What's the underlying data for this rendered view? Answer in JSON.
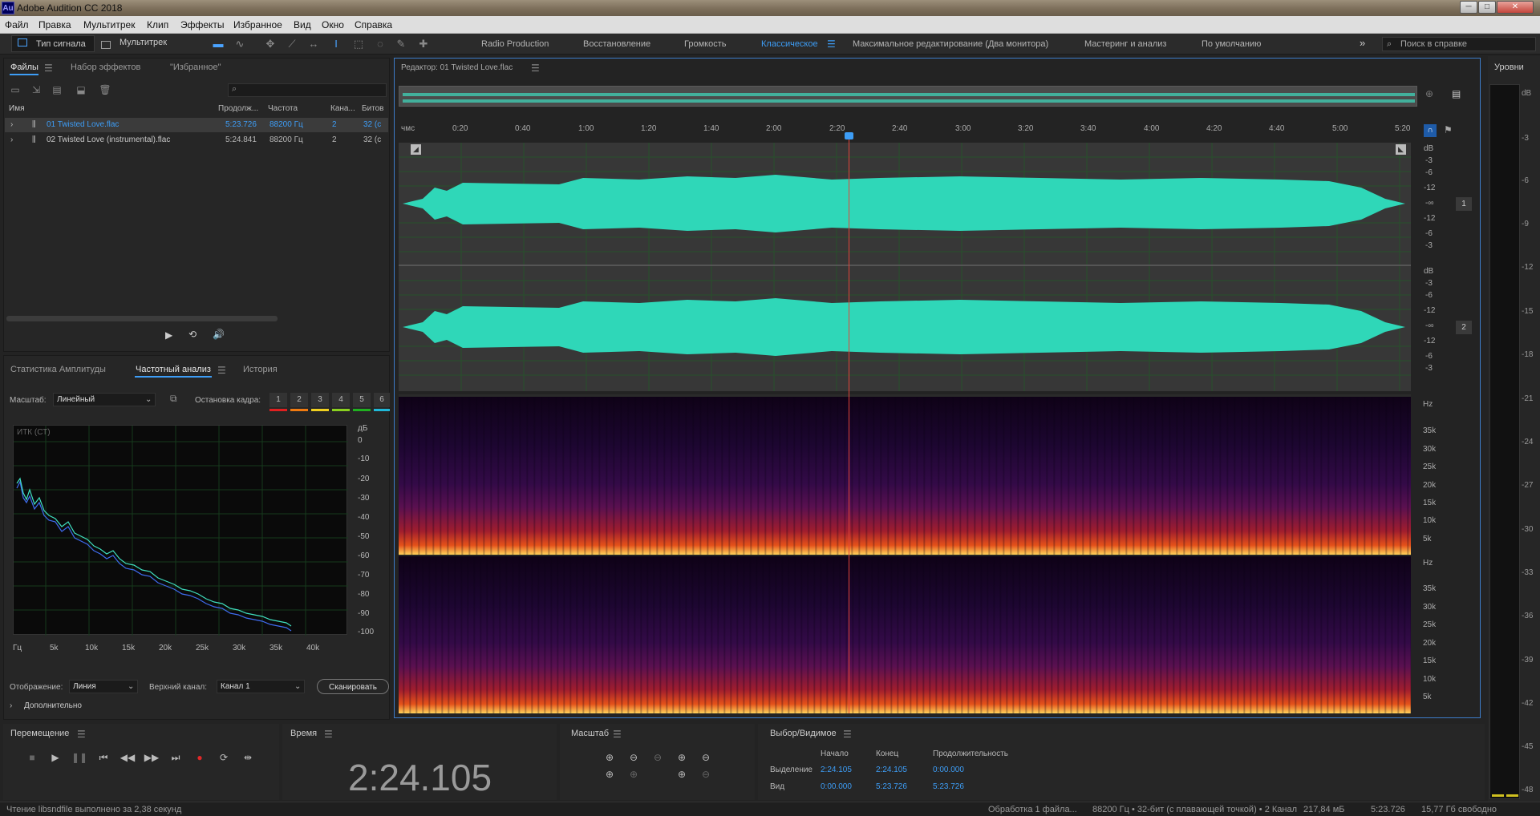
{
  "window": {
    "title": "Adobe Audition CC 2018",
    "icon": "Au",
    "minimize": "─",
    "maximize": "□",
    "close": "✕"
  },
  "menu": [
    "Файл",
    "Правка",
    "Мультитрек",
    "Клип",
    "Эффекты",
    "Избранное",
    "Вид",
    "Окно",
    "Справка"
  ],
  "toolbar": {
    "tab_waveform": "Тип сигнала",
    "tab_multitrack": "Мультитрек",
    "workspaces": [
      "Radio Production",
      "Восстановление",
      "Громкость",
      "Классическое",
      "Максимальное редактирование (Два монитора)",
      "Мастеринг и анализ",
      "По умолчанию"
    ],
    "active_workspace": "Классическое",
    "more": "»",
    "help_search": "Поиск в справке"
  },
  "files_panel": {
    "tabs": [
      "Файлы",
      "Набор эффектов",
      "\"Избранное\""
    ],
    "search_placeholder": "",
    "columns": [
      "Имя",
      "Продолж...",
      "Частота",
      "Кана...",
      "Битов"
    ],
    "rows": [
      {
        "name": "01 Twisted Love.flac",
        "duration": "5:23.726",
        "rate": "88200 Гц",
        "channels": "2",
        "bits": "32 (с"
      },
      {
        "name": "02 Twisted Love (instrumental).flac",
        "duration": "5:24.841",
        "rate": "88200 Гц",
        "channels": "2",
        "bits": "32 (с"
      }
    ]
  },
  "analysis_panel": {
    "tabs": [
      "Статистика Амплитуды",
      "Частотный анализ",
      "История"
    ],
    "scale_label": "Масштаб:",
    "scale_value": "Линейный",
    "freeze_label": "Остановка кадра:",
    "freeze_buttons": [
      "1",
      "2",
      "3",
      "4",
      "5",
      "6"
    ],
    "freeze_colors": [
      "#e02020",
      "#f07a10",
      "#f0d020",
      "#8ad020",
      "#20b020",
      "#20b8d8"
    ],
    "graph_label": "ИТК (СТ)",
    "db_unit": "дБ",
    "db_ticks": [
      "0",
      "-10",
      "-20",
      "-30",
      "-40",
      "-50",
      "-60",
      "-70",
      "-80",
      "-90",
      "-100"
    ],
    "freq_ticks": [
      "Гц",
      "5k",
      "10k",
      "15k",
      "20k",
      "25k",
      "30k",
      "35k",
      "40k"
    ],
    "display_label": "Отображение:",
    "display_value": "Линия",
    "channel_label": "Верхний канал:",
    "channel_value": "Канал 1",
    "scan_button": "Сканировать",
    "advanced": "Дополнительно"
  },
  "editor": {
    "title": "Редактор: 01 Twisted Love.flac",
    "time_ticks": [
      "чмс",
      "0:20",
      "0:40",
      "1:00",
      "1:20",
      "1:40",
      "2:00",
      "2:20",
      "2:40",
      "3:00",
      "3:20",
      "3:40",
      "4:00",
      "4:20",
      "4:40",
      "5:00",
      "5:20"
    ],
    "db_ticks": [
      "dB",
      "-3",
      "-6",
      "-12",
      "-∞",
      "-12",
      "-6",
      "-3"
    ],
    "channel_badges": [
      "1",
      "2"
    ],
    "hz_ticks": [
      "Hz",
      "35k",
      "30k",
      "25k",
      "20k",
      "15k",
      "10k",
      "5k"
    ],
    "playhead": 0.4449
  },
  "transport": {
    "title": "Перемещение"
  },
  "time": {
    "title": "Время",
    "value": "2:24.105"
  },
  "zoom": {
    "title": "Масштаб"
  },
  "selection": {
    "title": "Выбор/Видимое",
    "headers": [
      "Начало",
      "Конец",
      "Продолжительность"
    ],
    "selection_label": "Выделение",
    "view_label": "Вид",
    "selection_values": [
      "2:24.105",
      "2:24.105",
      "0:00.000"
    ],
    "view_values": [
      "0:00.000",
      "5:23.726",
      "5:23.726"
    ]
  },
  "levels": {
    "title": "Уровни",
    "ticks": [
      "dB",
      "-3",
      "-6",
      "-9",
      "-12",
      "-15",
      "-18",
      "-21",
      "-24",
      "-27",
      "-30",
      "-33",
      "-36",
      "-39",
      "-42",
      "-45",
      "-48"
    ]
  },
  "status": {
    "left": "Чтение libsndfile выполнено за 2,38 секунд",
    "processing": "Обработка 1 файла...",
    "format": "88200 Гц • 32-бит (с плавающей точкой) • 2 Канал",
    "size": "217,84 мБ",
    "duration": "5:23.726",
    "free": "15,77 Гб свободно"
  }
}
